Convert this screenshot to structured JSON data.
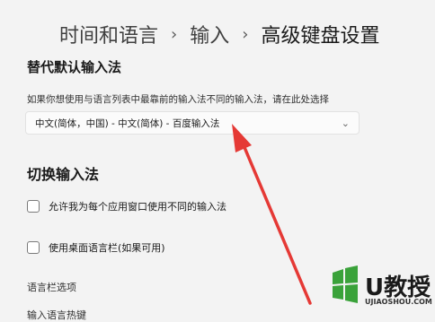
{
  "breadcrumb": {
    "item1": "时间和语言",
    "sep": "›",
    "item2": "输入",
    "item3": "高级键盘设置"
  },
  "override_section": {
    "title": "替代默认输入法",
    "description": "如果你想使用与语言列表中最靠前的输入法不同的输入法，请在此处选择",
    "dropdown_value": "中文(简体，中国) - 中文(简体) - 百度输入法"
  },
  "switch_section": {
    "title": "切换输入法",
    "checkbox1_label": "允许我为每个应用窗口使用不同的输入法",
    "checkbox2_label": "使用桌面语言栏(如果可用)"
  },
  "links": {
    "language_bar_options": "语言栏选项",
    "input_hotkeys": "输入语言热键"
  },
  "watermark": {
    "brand": "U教授",
    "url": "UJIAOSHOU.COM"
  },
  "colors": {
    "arrow": "#e53935",
    "logo_green": "#3aa23a"
  }
}
